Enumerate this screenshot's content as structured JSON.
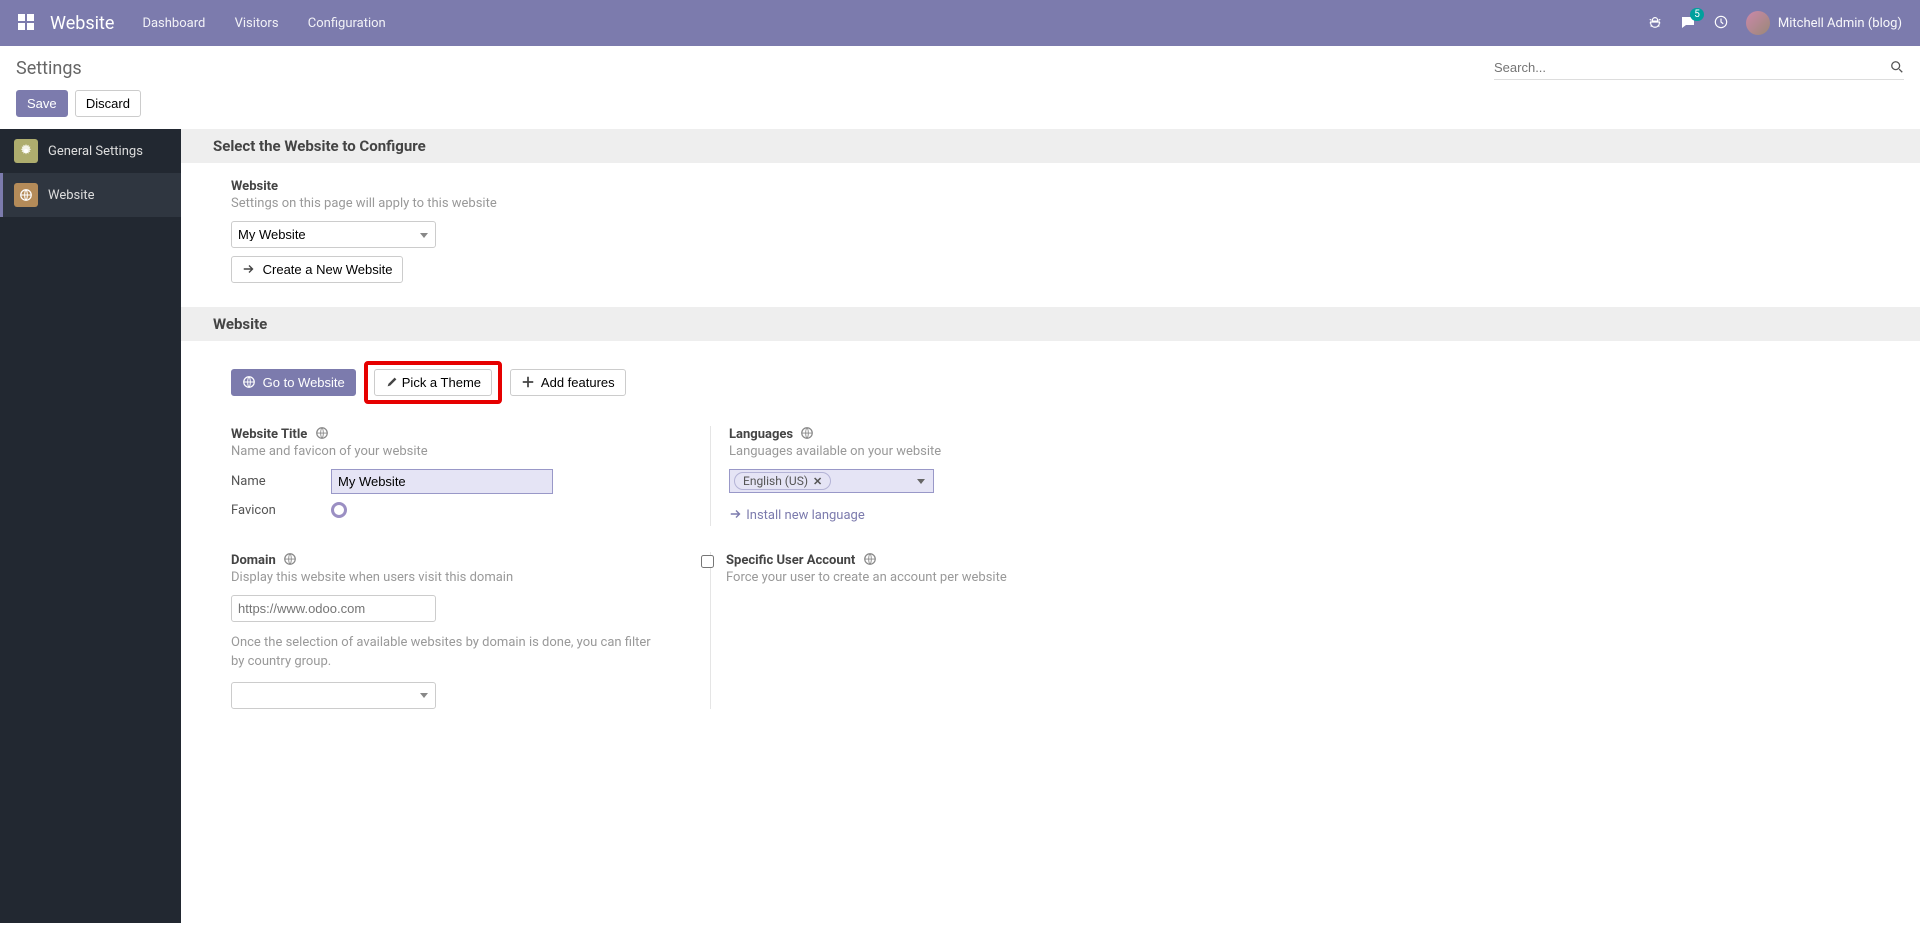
{
  "topnav": {
    "brand": "Website",
    "menu": [
      "Dashboard",
      "Visitors",
      "Configuration"
    ],
    "badge_count": "5",
    "user_name": "Mitchell Admin (blog)"
  },
  "header": {
    "title": "Settings",
    "search_placeholder": "Search..."
  },
  "actions": {
    "save": "Save",
    "discard": "Discard"
  },
  "sidebar": {
    "items": [
      {
        "label": "General Settings"
      },
      {
        "label": "Website"
      }
    ]
  },
  "sections": {
    "select_site": {
      "band": "Select the Website to Configure",
      "label": "Website",
      "help": "Settings on this page will apply to this website",
      "selected": "My Website",
      "create_btn": "Create a New Website"
    },
    "website": {
      "band": "Website",
      "go_btn": "Go to Website",
      "pick_btn": "Pick a Theme",
      "add_btn": "Add features",
      "title": {
        "label": "Website Title",
        "help": "Name and favicon of your website",
        "name_label": "Name",
        "name_value": "My Website",
        "favicon_label": "Favicon"
      },
      "languages": {
        "label": "Languages",
        "help": "Languages available on your website",
        "tag": "English (US)",
        "install_link": "Install new language"
      },
      "domain": {
        "label": "Domain",
        "help": "Display this website when users visit this domain",
        "placeholder": "https://www.odoo.com",
        "note": "Once the selection of available websites by domain is done, you can filter by country group."
      },
      "specific_user": {
        "label": "Specific User Account",
        "help": "Force your user to create an account per website"
      }
    }
  }
}
